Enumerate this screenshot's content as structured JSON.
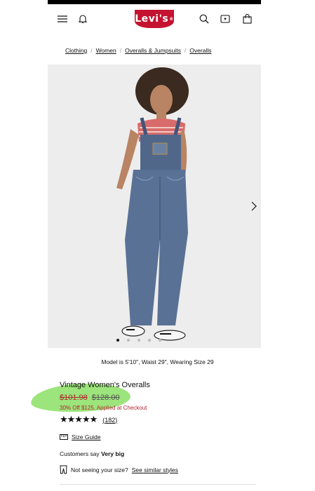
{
  "header": {
    "logo_text": "Levi's",
    "icons": [
      "menu-icon",
      "bell-icon",
      "search-icon",
      "ai-search-icon",
      "bag-icon"
    ]
  },
  "breadcrumb": [
    "Clothing",
    "Women",
    "Overalls & Jumpsuits",
    "Overalls"
  ],
  "gallery": {
    "dot_count": 5,
    "active_dot": 1
  },
  "model_info": "Model is 5'10\", Waist 29\", Wearing Size 29",
  "product": {
    "title": "Vintage Women's Overalls",
    "sale_price": "$101.98",
    "original_price": "$128.00",
    "promo": "30% Off $125. Applied at Checkout",
    "rating_value": 4.5,
    "stars": "★★★★★",
    "review_count": "(182)"
  },
  "size_guide_label": "Size Guide",
  "fit": {
    "prefix": "Customers say",
    "value": "Very big"
  },
  "similar": {
    "question": "Not seeing your size?",
    "link": "See similar styles"
  },
  "colors": {
    "brand_red": "#c41230",
    "sale_red": "#b3262e",
    "highlight_green": "#8ee06a"
  }
}
